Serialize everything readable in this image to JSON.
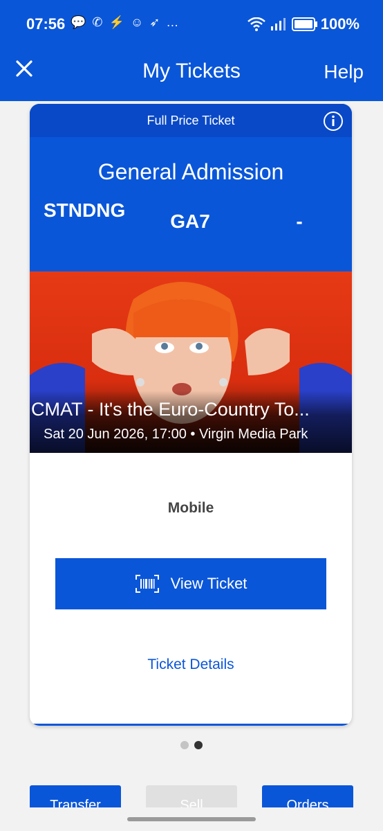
{
  "status_bar": {
    "time": "07:56",
    "notification_icons": "💬 ✆ ⚡ ☺ ➶ …",
    "battery": "100%"
  },
  "header": {
    "title": "My Tickets",
    "help": "Help"
  },
  "ticket": {
    "ticket_type": "Full Price Ticket",
    "admission": "General Admission",
    "section": "STNDNG",
    "row": "GA7",
    "seat": "-",
    "event_name": "CMAT - It's the Euro-Country To...",
    "event_subtitle": "Sat 20 Jun 2026, 17:00 • Virgin Media Park",
    "delivery_method": "Mobile",
    "view_ticket_label": "View Ticket",
    "ticket_details_label": "Ticket Details"
  },
  "pager": {
    "total": 2,
    "active_index": 1
  },
  "actions": {
    "transfer": "Transfer",
    "sell": "Sell",
    "orders": "Orders"
  },
  "colors": {
    "primary": "#0a56d8",
    "ticket_band": "#0949c7"
  },
  "icons": {
    "close": "close-icon",
    "info": "info-icon",
    "barcode": "barcode-icon"
  }
}
